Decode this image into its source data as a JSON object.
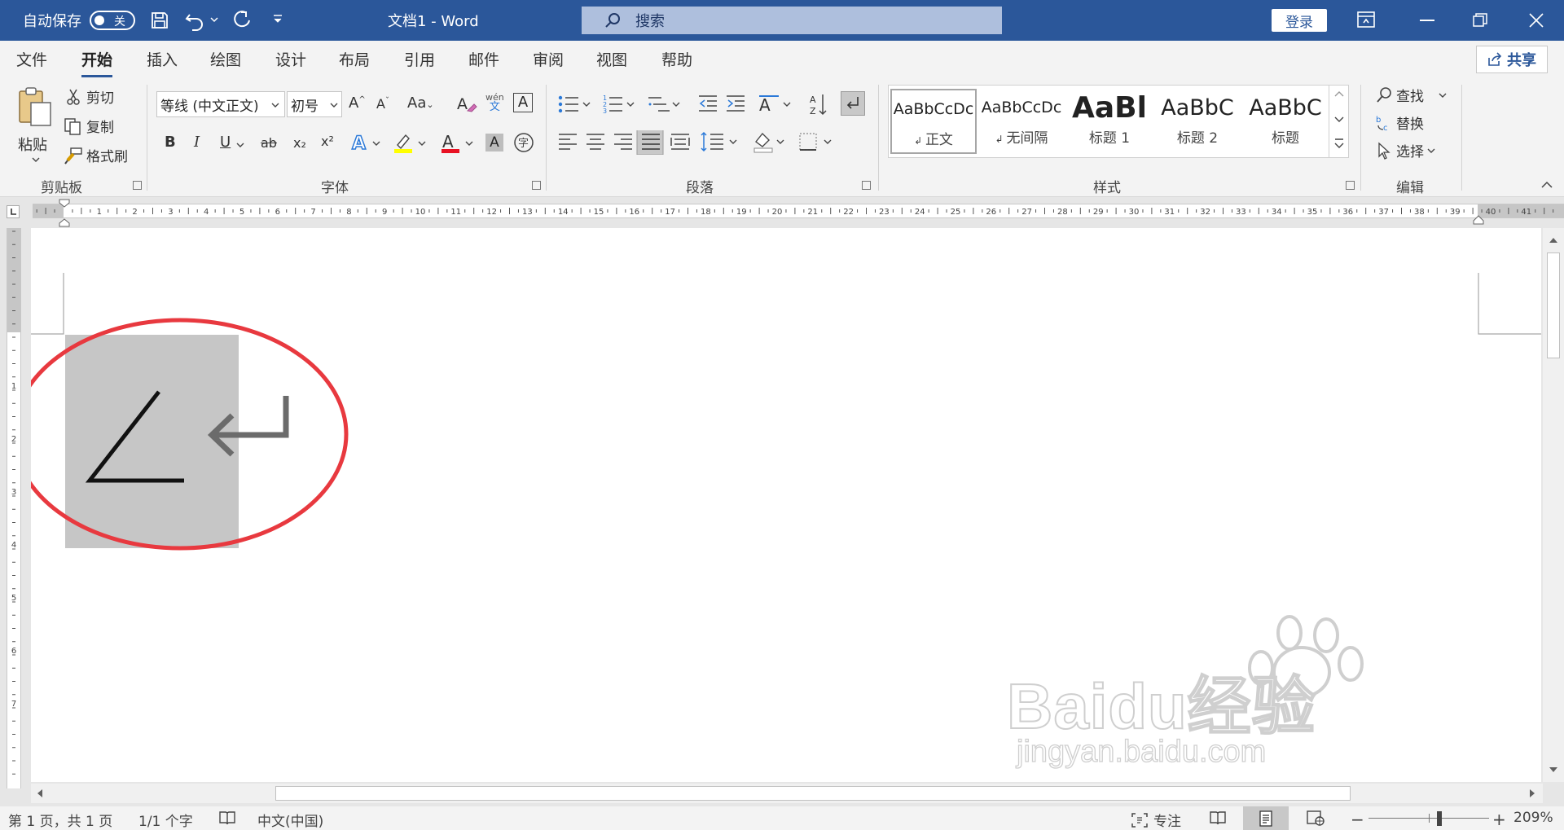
{
  "title_bar": {
    "autosave_label": "自动保存",
    "autosave_state": "关",
    "doc_title": "文档1  -  Word",
    "search_placeholder": "搜索",
    "login_label": "登录"
  },
  "menu": {
    "tabs": [
      "文件",
      "开始",
      "插入",
      "绘图",
      "设计",
      "布局",
      "引用",
      "邮件",
      "审阅",
      "视图",
      "帮助"
    ],
    "active_tab": "开始",
    "share_label": "共享"
  },
  "ribbon": {
    "clipboard": {
      "paste": "粘贴",
      "cut": "剪切",
      "copy": "复制",
      "format_painter": "格式刷",
      "group_label": "剪贴板"
    },
    "font": {
      "font_name": "等线 (中文正文)",
      "font_size": "初号",
      "phonetic_top": "wén",
      "phonetic_bottom": "文",
      "bold": "B",
      "italic": "I",
      "underline": "U",
      "strike": "ab",
      "subscript": "x₂",
      "superscript": "x²",
      "change_case": "Aa",
      "group_label": "字体"
    },
    "paragraph": {
      "group_label": "段落"
    },
    "styles": {
      "items": [
        {
          "preview": "AaBbCcDc",
          "name": "正文"
        },
        {
          "preview": "AaBbCcDc",
          "name": "无间隔"
        },
        {
          "preview": "AaBl",
          "name": "标题 1"
        },
        {
          "preview": "AaBbC",
          "name": "标题 2"
        },
        {
          "preview": "AaBbC",
          "name": "标题"
        }
      ],
      "group_label": "样式"
    },
    "editing": {
      "find": "查找",
      "replace": "替换",
      "select": "选择",
      "group_label": "编辑"
    }
  },
  "ruler": {
    "h_labels": [
      "1",
      "2",
      "3",
      "4",
      "5",
      "6",
      "7",
      "8",
      "9",
      "10",
      "11",
      "12",
      "13",
      "14",
      "15",
      "16",
      "17",
      "18",
      "19",
      "20",
      "21",
      "22",
      "23",
      "24",
      "25",
      "26",
      "27",
      "28",
      "29",
      "30",
      "31",
      "32",
      "33",
      "34",
      "35",
      "36",
      "37",
      "38",
      "39",
      "40",
      "41"
    ],
    "v_labels": [
      "1",
      "2",
      "3",
      "4",
      "5",
      "6",
      "7"
    ]
  },
  "document": {
    "content_symbol": "∠",
    "paragraph_mark": "↵",
    "watermark_brand": "Baidu经验",
    "watermark_url": "jingyan.baidu.com"
  },
  "colors": {
    "title_bar": "#2b579a",
    "highlight_circle": "#e8393f",
    "selection": "#c6c6c6"
  },
  "status_bar": {
    "page": "第 1 页，共 1 页",
    "words": "1/1 个字",
    "language": "中文(中国)",
    "focus": "专注",
    "zoom": "209%",
    "zoom_minus": "−",
    "zoom_plus": "+"
  }
}
